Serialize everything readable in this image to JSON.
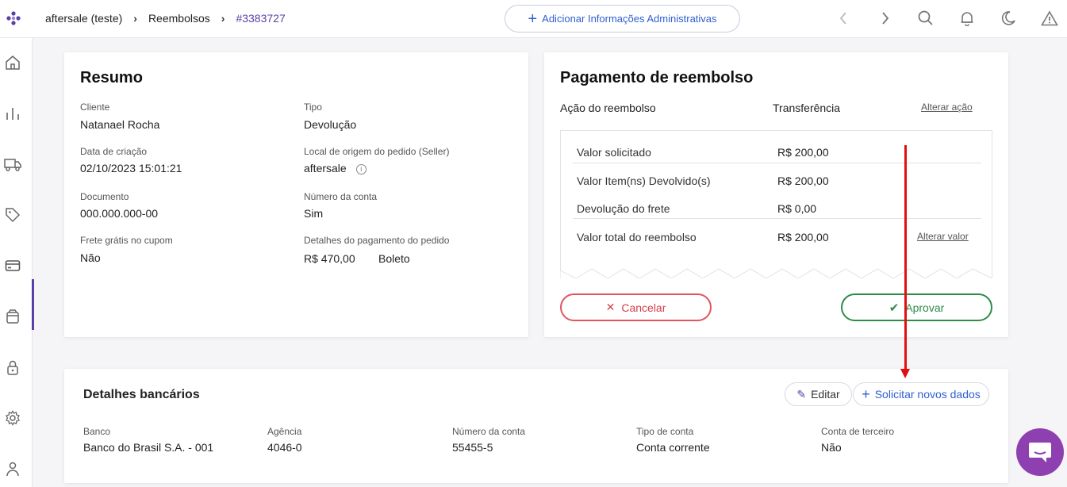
{
  "breadcrumb": {
    "store": "aftersale (teste)",
    "section": "Reembolsos",
    "current": "#3383727"
  },
  "header": {
    "admin_button": "Adicionar Informações Administrativas"
  },
  "resumo": {
    "title": "Resumo",
    "fields": {
      "cliente_label": "Cliente",
      "cliente_value": "Natanael Rocha",
      "tipo_label": "Tipo",
      "tipo_value": "Devolução",
      "data_label": "Data de criação",
      "data_value": "02/10/2023 15:01:21",
      "origem_label": "Local de origem do pedido (Seller)",
      "origem_value": "aftersale",
      "documento_label": "Documento",
      "documento_value": "000.000.000-00",
      "conta_label": "Número da conta",
      "conta_value": "Sim",
      "frete_label": "Frete grátis no cupom",
      "frete_value": "Não",
      "pagamento_label": "Detalhes do pagamento do pedido",
      "pagamento_valor": "R$ 470,00",
      "pagamento_metodo": "Boleto"
    }
  },
  "pagamento": {
    "title": "Pagamento de reembolso",
    "acao_label": "Ação do reembolso",
    "acao_value": "Transferência",
    "alterar_acao": "Alterar ação",
    "rows": [
      {
        "label": "Valor solicitado",
        "value": "R$ 200,00"
      },
      {
        "label": "Valor Item(ns) Devolvido(s)",
        "value": "R$ 200,00"
      },
      {
        "label": "Devolução do frete",
        "value": "R$ 0,00"
      },
      {
        "label": "Valor total do reembolso",
        "value": "R$ 200,00"
      }
    ],
    "alterar_valor": "Alterar valor",
    "cancelar": "Cancelar",
    "aprovar": "Aprovar"
  },
  "bancarios": {
    "title": "Detalhes bancários",
    "editar": "Editar",
    "solicitar": "Solicitar novos dados",
    "fields": [
      {
        "label": "Banco",
        "value": "Banco do Brasil S.A. - 001"
      },
      {
        "label": "Agência",
        "value": "4046-0"
      },
      {
        "label": "Número da conta",
        "value": "55455-5"
      },
      {
        "label": "Tipo de conta",
        "value": "Conta corrente"
      },
      {
        "label": "Conta de terceiro",
        "value": "Não"
      }
    ]
  },
  "colors": {
    "accent": "#5b3fa8",
    "link_blue": "#2f5fd0",
    "danger": "#d43f4a",
    "success": "#2e8b4a",
    "annotation_arrow": "#e01010"
  }
}
